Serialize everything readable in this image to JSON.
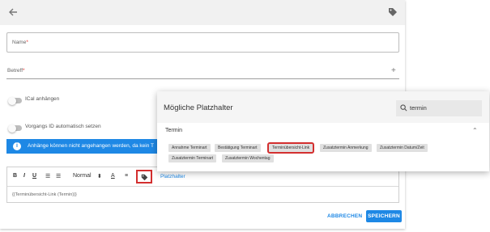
{
  "form": {
    "name_label": "Name",
    "required_mark": "*",
    "betreff_label": "Betreff",
    "ical_label": "ICal anhängen",
    "vorgangs_label": "Vorgangs ID automatisch setzen",
    "info_text": "Anhänge können nicht angehangen werden, da kein T",
    "info_icon_glyph": "i",
    "plus_glyph": "+"
  },
  "editor": {
    "bold": "B",
    "italic": "I",
    "underline": "U",
    "ordered_list": "☰",
    "bullet_list": "☰",
    "format_select": "Normal",
    "select_arrows": "⬍",
    "font_color": "A",
    "align": "≡",
    "platzhalter_link": "Platzhalter",
    "content": "{{Terminübersicht-Link (Termin)}}"
  },
  "actions": {
    "cancel_label": "ABBRECHEN",
    "save_label": "SPEICHERN"
  },
  "popup": {
    "title": "Mögliche Platzhalter",
    "search_value": "termin",
    "section_title": "Termin",
    "chevron": "⌃",
    "chips": [
      "Annahme Terminart",
      "Bestätigung Terminart",
      "Terminübersicht-Link",
      "Zusatztermin Anmerkung",
      "Zusatztermin Datum/Zeit",
      "Zusatztermin Terminart",
      "Zusatztermin Wochentag"
    ]
  },
  "colors": {
    "accent": "#1e88e5",
    "highlight": "#d32f2f",
    "chip_bg": "#e0e0e0"
  }
}
